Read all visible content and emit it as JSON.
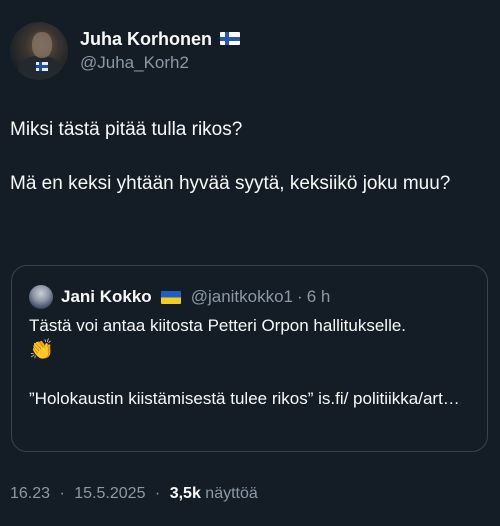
{
  "author": {
    "name": "Juha Korhonen",
    "handle": "@Juha_Korh2",
    "flag_icon": "finland-flag-icon"
  },
  "tweet": {
    "lines": [
      "Miksi tästä pitää tulla rikos?",
      "Mä en keksi yhtään hyvää syytä, keksiikö joku muu?"
    ]
  },
  "quoted": {
    "name": "Jani Kokko",
    "flag_icon": "ukraine-flag-icon",
    "handle": "@janitkokko1",
    "separator": "·",
    "time": "6 h",
    "text_line_1": "Tästä voi antaa kiitosta Petteri Orpon hallitukselle.",
    "emoji": "👏",
    "text_line_2": "”Holokaustin kiistämisestä tulee rikos” is.fi/ politiikka/art…"
  },
  "meta": {
    "time": "16.23",
    "separator": "·",
    "date": "15.5.2025",
    "views_count": "3,5k",
    "views_label": "näyttöä"
  },
  "colors": {
    "background": "#141d26",
    "text": "#f7f9f9",
    "secondary_text": "#8b98a5",
    "border": "#38444d"
  }
}
